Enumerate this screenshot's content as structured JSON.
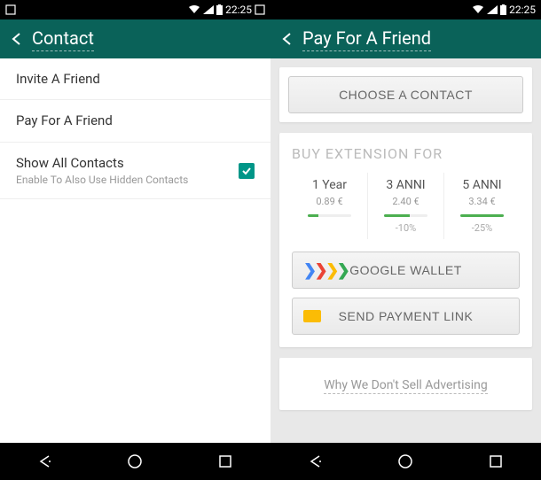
{
  "status": {
    "time": "22:25"
  },
  "left": {
    "header": {
      "title": "Contact"
    },
    "items": {
      "invite": "Invite A Friend",
      "pay": "Pay For A Friend",
      "showAll": "Show All Contacts",
      "showAllSub": "Enable To Also Use Hidden Contacts"
    }
  },
  "right": {
    "header": {
      "title": "Pay For A Friend"
    },
    "chooseContact": "CHOOSE A CONTACT",
    "buyTitle": "BUY EXTENSION FOR",
    "plans": [
      {
        "name": "1 Year",
        "price": "0.89 €",
        "fill": 25,
        "discount": ""
      },
      {
        "name": "3 ANNI",
        "price": "2.40 €",
        "fill": 60,
        "discount": "-10%"
      },
      {
        "name": "5 ANNI",
        "price": "3.34 €",
        "fill": 100,
        "discount": "-25%"
      }
    ],
    "googleWallet": "GOOGLE WALLET",
    "sendPayment": "SEND PAYMENT LINK",
    "advertising": "Why We Don't Sell Advertising"
  }
}
